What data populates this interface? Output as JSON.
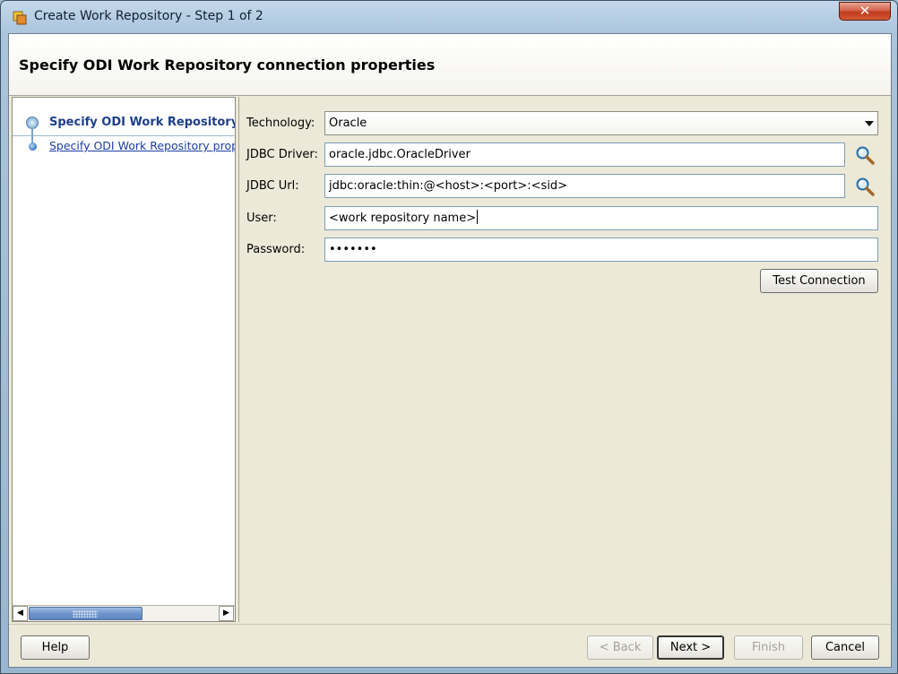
{
  "window": {
    "title": "Create Work Repository - Step 1 of 2",
    "close_glyph": "✕"
  },
  "header": {
    "title": "Specify ODI Work Repository connection properties"
  },
  "nav": {
    "items": [
      {
        "label": "Specify ODI Work Repository",
        "state": "current"
      },
      {
        "label": "Specify ODI Work Repository prop",
        "state": "link"
      }
    ],
    "scroll": {
      "left_arrow": "◀",
      "right_arrow": "▶"
    }
  },
  "form": {
    "technology": {
      "label": "Technology:",
      "value": "Oracle"
    },
    "jdbc_driver": {
      "label": "JDBC Driver:",
      "value": "oracle.jdbc.OracleDriver"
    },
    "jdbc_url": {
      "label": "JDBC Url:",
      "value": "jdbc:oracle:thin:@<host>:<port>:<sid>"
    },
    "user": {
      "label": "User:",
      "value": "<work repository name>"
    },
    "password": {
      "label": "Password:",
      "value": "•••••••"
    },
    "test_connection_label": "Test Connection"
  },
  "footer": {
    "help_label": "Help",
    "back_label": "< Back",
    "next_label": "Next >",
    "finish_label": "Finish",
    "cancel_label": "Cancel"
  },
  "colors": {
    "dialog_bg": "#ece9d8",
    "current_step_text": "#1d3f8c",
    "link_text": "#1b3ea5",
    "close_button": "#c0391c"
  },
  "icons": [
    "app-icon",
    "close-icon",
    "search-icon",
    "chevron-down-icon",
    "arrow-left-icon",
    "arrow-right-icon"
  ]
}
